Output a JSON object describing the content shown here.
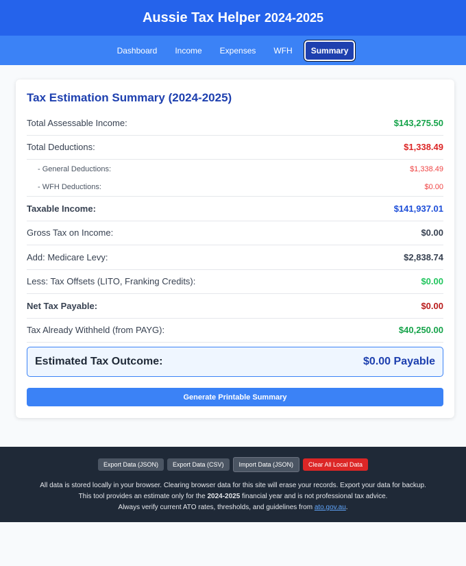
{
  "header": {
    "title": "Aussie Tax Helper",
    "year": "2024-2025"
  },
  "nav": [
    "Dashboard",
    "Income",
    "Expenses",
    "WFH",
    "Summary"
  ],
  "summary": {
    "title": "Tax Estimation Summary (2024-2025)",
    "rows": [
      {
        "label": "Total Assessable Income:",
        "value": "$143,275.50",
        "color": "#16a34a"
      },
      {
        "label": "Total Deductions:",
        "value": "$1,338.49",
        "color": "#dc2626"
      },
      {
        "label": "- General Deductions:",
        "value": "$1,338.49",
        "color": "#ef4444"
      },
      {
        "label": "- WFH Deductions:",
        "value": "$0.00",
        "color": "#ef4444"
      },
      {
        "label": "Taxable Income:",
        "value": "$141,937.01",
        "color": "#1d4ed8"
      },
      {
        "label": "Gross Tax on Income:",
        "value": "$0.00",
        "color": "#374151"
      },
      {
        "label": "Add: Medicare Levy:",
        "value": "$2,838.74",
        "color": "#374151"
      },
      {
        "label": "Less: Tax Offsets (LITO, Franking Credits):",
        "value": "$0.00",
        "color": "#22c55e"
      },
      {
        "label": "Net Tax Payable:",
        "value": "$0.00",
        "color": "#b91c1c"
      },
      {
        "label": "Tax Already Withheld (from PAYG):",
        "value": "$40,250.00",
        "color": "#16a34a"
      }
    ],
    "outcome_label": "Estimated Tax Outcome:",
    "outcome_value": "$0.00 Payable",
    "generate_button": "Generate Printable Summary"
  },
  "footer": {
    "buttons": [
      "Export Data (JSON)",
      "Export Data (CSV)",
      "Import Data (JSON)",
      "Clear All Local Data"
    ],
    "line1": "All data is stored locally in your browser. Clearing browser data for this site will erase your records. Export your data for backup.",
    "line2_pre": "This tool provides an estimate only for the ",
    "line2_bold": "2024-2025",
    "line2_post": " financial year and is not professional tax advice.",
    "line3_pre": "Always verify current ATO rates, thresholds, and guidelines from ",
    "line3_link": "ato.gov.au",
    "line3_post": "."
  }
}
